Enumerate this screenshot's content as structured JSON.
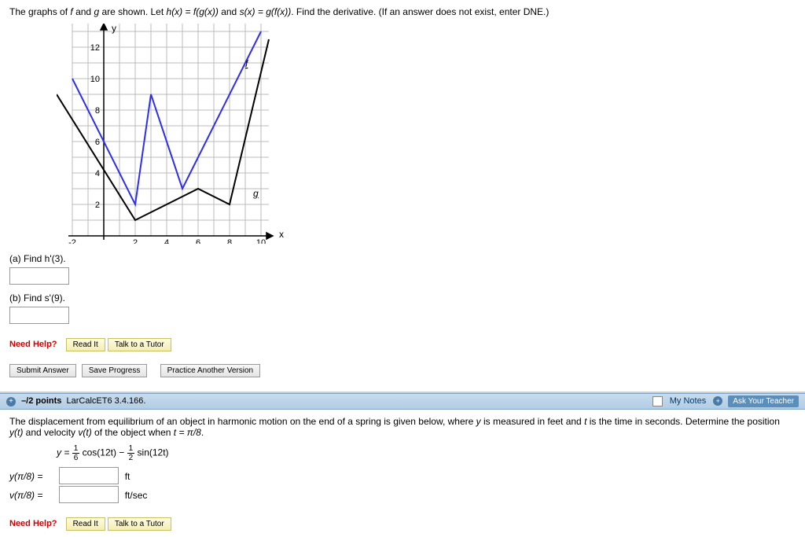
{
  "q1": {
    "prompt_a": "The graphs of ",
    "prompt_b": " and ",
    "prompt_c": " are shown. Let  ",
    "prompt_d": "h(x) = f(g(x))",
    "prompt_e": "  and  ",
    "prompt_f": "s(x) = g(f(x))",
    "prompt_g": ".  Find the derivative. (If an answer does not exist, enter DNE.)",
    "f": "f",
    "g": "g",
    "partA": "(a) Find  h'(3).",
    "partB": "(b) Find  s'(9).",
    "needHelp": "Need Help?",
    "readIt": "Read It",
    "talkTutor": "Talk to a Tutor",
    "submit": "Submit Answer",
    "save": "Save Progress",
    "practice": "Practice Another Version",
    "axis_y": "y",
    "axis_x": "x",
    "graph_f_label": "f",
    "graph_g_label": "g"
  },
  "chart_data": {
    "type": "line",
    "title": "",
    "xlabel": "x",
    "ylabel": "y",
    "xlim": [
      -3,
      10.5
    ],
    "ylim": [
      -1,
      13.5
    ],
    "xticks": [
      -2,
      2,
      4,
      6,
      8,
      10
    ],
    "yticks": [
      2,
      4,
      6,
      8,
      10,
      12
    ],
    "series": [
      {
        "name": "f",
        "color": "#2e2ef0",
        "points": [
          [
            -2,
            10
          ],
          [
            2,
            2
          ],
          [
            3,
            9
          ],
          [
            5,
            3
          ],
          [
            10,
            13
          ]
        ]
      },
      {
        "name": "g",
        "color": "#000000",
        "points": [
          [
            -3,
            9
          ],
          [
            2,
            1
          ],
          [
            6,
            3
          ],
          [
            8,
            2
          ],
          [
            10.5,
            12.5
          ]
        ]
      }
    ]
  },
  "q2header": {
    "points": "–/2 points",
    "ref": "LarCalcET6 3.4.166.",
    "myNotes": "My Notes",
    "ask": "Ask Your Teacher"
  },
  "q2": {
    "prompt_a": "The displacement from equilibrium of an object in harmonic motion on the end of a spring is given below, where ",
    "prompt_y": "y",
    "prompt_b": " is measured in feet and ",
    "prompt_t": "t",
    "prompt_c": " is the time in seconds. Determine the position ",
    "prompt_yt": "y(t)",
    "prompt_d": " and velocity ",
    "prompt_vt": "v(t)",
    "prompt_e": " of the object when ",
    "prompt_tval": "t = π/8",
    "prompt_f": ".",
    "eq_left": "y = ",
    "eq_cos": " cos(12t) − ",
    "eq_sin": " sin(12t)",
    "frac1_num": "1",
    "frac1_den": "6",
    "frac2_num": "1",
    "frac2_den": "2",
    "row1_label": "y(π/8) =",
    "row1_unit": "ft",
    "row2_label": "v(π/8) =",
    "row2_unit": "ft/sec",
    "needHelp": "Need Help?",
    "readIt": "Read It",
    "talkTutor": "Talk to a Tutor"
  }
}
